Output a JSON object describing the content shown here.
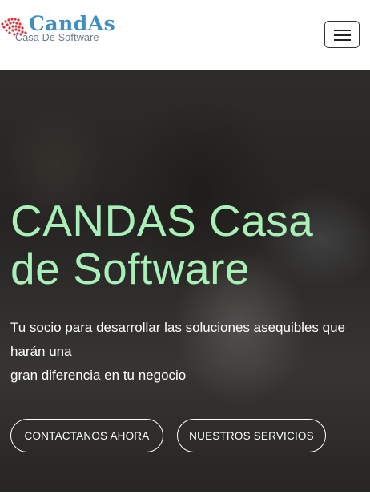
{
  "header": {
    "logo_name": "CandAs",
    "logo_tagline": "Casa De Software",
    "menu_toggle_icon": "hamburger-icon"
  },
  "hero": {
    "title": "CANDAS Casa de Software",
    "subtitle_line1": "Tu socio para desarrollar las soluciones asequibles que harán una",
    "subtitle_line2": "gran diferencia en tu negocio",
    "buttons": {
      "contact": "CONTACTANOS AHORA",
      "services": "NUESTROS SERVICIOS"
    }
  },
  "colors": {
    "brand_blue": "#3d8fc5",
    "logo_dots_red": "#d9343a",
    "title_green": "#a8f0b8"
  }
}
